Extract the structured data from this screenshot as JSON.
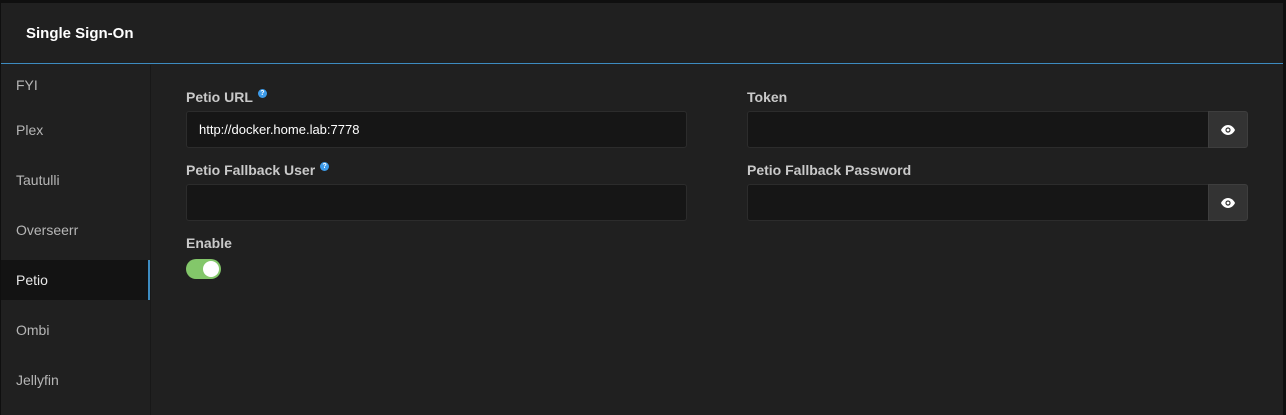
{
  "header": {
    "title": "Single Sign-On"
  },
  "sidebar": {
    "items": [
      {
        "label": "FYI"
      },
      {
        "label": "Plex"
      },
      {
        "label": "Tautulli"
      },
      {
        "label": "Overseerr"
      },
      {
        "label": "Petio"
      },
      {
        "label": "Ombi"
      },
      {
        "label": "Jellyfin"
      }
    ],
    "active": "Petio"
  },
  "form": {
    "petio_url": {
      "label": "Petio URL",
      "value": "http://docker.home.lab:7778",
      "help_icon": "question-circle-icon"
    },
    "token": {
      "label": "Token",
      "value": "",
      "reveal_icon": "eye-icon"
    },
    "fallback_user": {
      "label": "Petio Fallback User",
      "value": "",
      "help_icon": "question-circle-icon"
    },
    "fallback_password": {
      "label": "Petio Fallback Password",
      "value": "",
      "reveal_icon": "eye-icon"
    },
    "enable": {
      "label": "Enable",
      "value": true
    }
  },
  "colors": {
    "accent": "#3d8bc0",
    "toggle_on": "#83c76a",
    "help_icon": "#3d9be9"
  }
}
